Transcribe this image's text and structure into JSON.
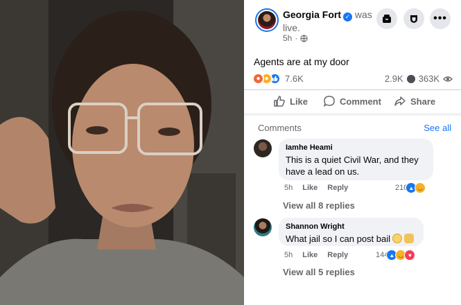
{
  "video": {
    "description_icon": "live-video-frame"
  },
  "post": {
    "author": "Georgia Fort",
    "status_text": "was live.",
    "time": "5h",
    "visibility_icon": "globe-icon",
    "caption": "Agents are at my door",
    "reaction_count": "7.6K",
    "comment_count": "2.9K",
    "view_count": "363K"
  },
  "header_buttons": {
    "messenger_icon": "messenger-icon",
    "shield_icon": "shield-icon",
    "more_label": "•••"
  },
  "actions": {
    "like": "Like",
    "comment": "Comment",
    "share": "Share"
  },
  "comments_section": {
    "title": "Comments",
    "see_all": "See all"
  },
  "comments": [
    {
      "author": "Iamhe Heami",
      "text": "This is a quiet Civil War, and they have a lead on us.",
      "time": "5h",
      "like_label": "Like",
      "reply_label": "Reply",
      "reaction_count": "210",
      "view_replies": "View all 8 replies"
    },
    {
      "author": "Shannon Wright",
      "text": "What jail so I can post bail",
      "time": "5h",
      "like_label": "Like",
      "reply_label": "Reply",
      "reaction_count": "144",
      "view_replies": "View all 5 replies"
    }
  ],
  "colors": {
    "accent": "#1877f2",
    "secondary_text": "#65676b",
    "bubble_bg": "#f0f2f5"
  }
}
